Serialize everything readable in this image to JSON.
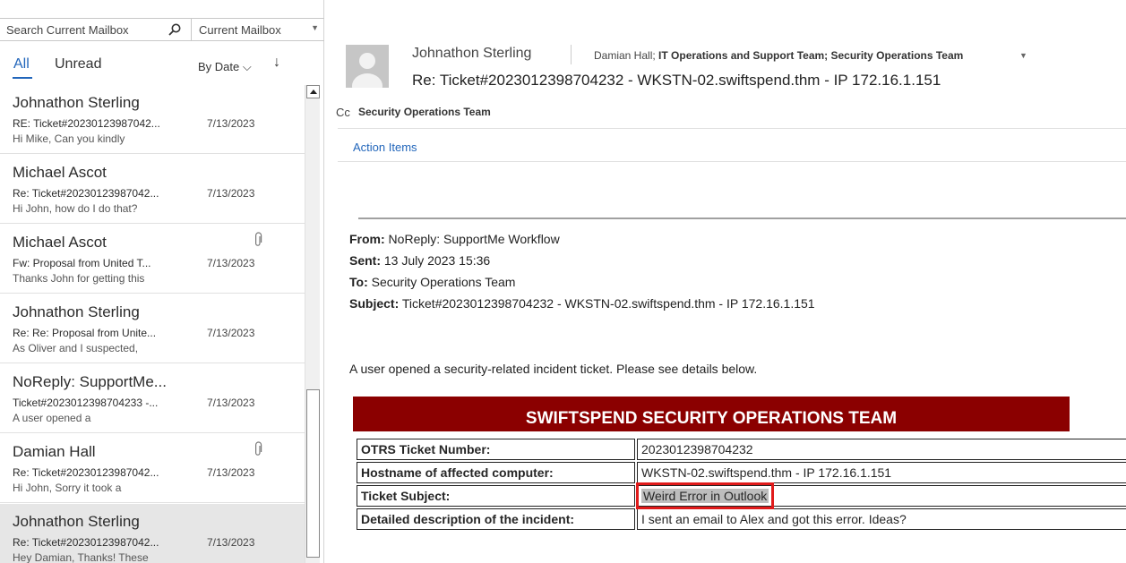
{
  "search": {
    "placeholder": "Search Current Mailbox",
    "scope": "Current Mailbox"
  },
  "filters": {
    "all": "All",
    "unread": "Unread",
    "sort": "By Date",
    "sort_arrow": "↓"
  },
  "messages": [
    {
      "from": "Johnathon Sterling",
      "subject": "RE: Ticket#20230123987042...",
      "date": "7/13/2023",
      "preview": "Hi Mike,  Can you kindly",
      "attachment": false,
      "selected": false
    },
    {
      "from": "Michael Ascot",
      "subject": "Re: Ticket#20230123987042...",
      "date": "7/13/2023",
      "preview": "Hi John, how do I do that?",
      "attachment": false,
      "selected": false
    },
    {
      "from": "Michael Ascot",
      "subject": "Fw: Proposal from United T...",
      "date": "7/13/2023",
      "preview": "Thanks John for getting this",
      "attachment": true,
      "selected": false
    },
    {
      "from": "Johnathon Sterling",
      "subject": "Re: Re: Proposal from Unite...",
      "date": "7/13/2023",
      "preview": "As Oliver and I suspected,",
      "attachment": false,
      "selected": false
    },
    {
      "from": "NoReply: SupportMe...",
      "subject": "Ticket#2023012398704233 -...",
      "date": "7/13/2023",
      "preview": "A user opened a",
      "attachment": false,
      "selected": false
    },
    {
      "from": "Damian Hall",
      "subject": "Re: Ticket#20230123987042...",
      "date": "7/13/2023",
      "preview": "Hi John,  Sorry it took a",
      "attachment": true,
      "selected": false
    },
    {
      "from": "Johnathon Sterling",
      "subject": "Re: Ticket#20230123987042...",
      "date": "7/13/2023",
      "preview": "Hey Damian,  Thanks! These",
      "attachment": false,
      "selected": true
    }
  ],
  "reading": {
    "sender": "Johnathon Sterling",
    "to_plain": "Damian Hall; ",
    "to_bold": "IT Operations and Support Team; Security Operations Team",
    "subject": "Re: Ticket#2023012398704232 - WKSTN-02.swiftspend.thm - IP 172.16.1.151",
    "cc_label": "Cc",
    "cc": "Security Operations Team",
    "action_items": "Action Items",
    "quoted": {
      "from_label": "From:",
      "from": " NoReply: SupportMe Workflow",
      "sent_label": "Sent:",
      "sent": " 13 July 2023 15:36",
      "to_label": "To:",
      "to": " Security Operations Team",
      "subject_label": "Subject:",
      "subject": " Ticket#2023012398704232 - WKSTN-02.swiftspend.thm - IP 172.16.1.151"
    },
    "intro": "A user opened a security-related incident ticket. Please see details below.",
    "banner": "SWIFTSPEND SECURITY OPERATIONS TEAM",
    "table": [
      {
        "key": "OTRS Ticket Number:",
        "value": "2023012398704232"
      },
      {
        "key": "Hostname of affected computer:",
        "value": "WKSTN-02.swiftspend.thm - IP 172.16.1.151"
      },
      {
        "key": "Ticket Subject:",
        "value": "Weird Error in Outlook",
        "highlight": true
      },
      {
        "key": "Detailed description of the incident:",
        "value": "I sent an email to Alex and got this error. Ideas?"
      }
    ]
  },
  "colors": {
    "accent": "#2266bb",
    "banner": "#8b0000",
    "highlight_box": "#e01b1b"
  }
}
